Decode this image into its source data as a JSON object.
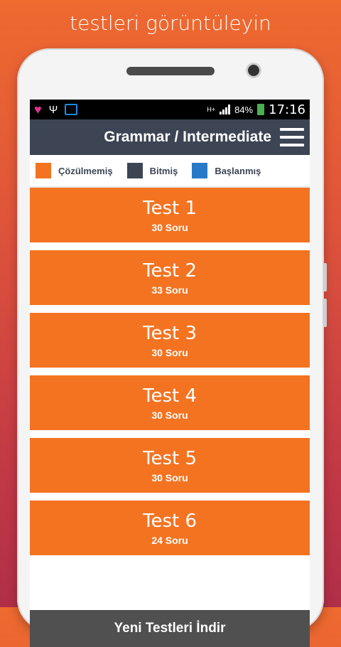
{
  "promo": {
    "caption": "testleri görüntüleyin"
  },
  "statusbar": {
    "network": "H+",
    "battery": "84%",
    "time": "17:16"
  },
  "appbar": {
    "title": "Grammar / Intermediate"
  },
  "legend": [
    {
      "label": "Çözülmemiş",
      "color": "#f47321"
    },
    {
      "label": "Bitmiş",
      "color": "#3d4554"
    },
    {
      "label": "Başlanmış",
      "color": "#2979c9"
    }
  ],
  "tests": [
    {
      "title": "Test 1",
      "count": "30 Soru"
    },
    {
      "title": "Test 2",
      "count": "33 Soru"
    },
    {
      "title": "Test 3",
      "count": "30 Soru"
    },
    {
      "title": "Test 4",
      "count": "30 Soru"
    },
    {
      "title": "Test 5",
      "count": "30 Soru"
    },
    {
      "title": "Test 6",
      "count": "24 Soru"
    }
  ],
  "footer": {
    "download_label": "Yeni Testleri İndir"
  }
}
